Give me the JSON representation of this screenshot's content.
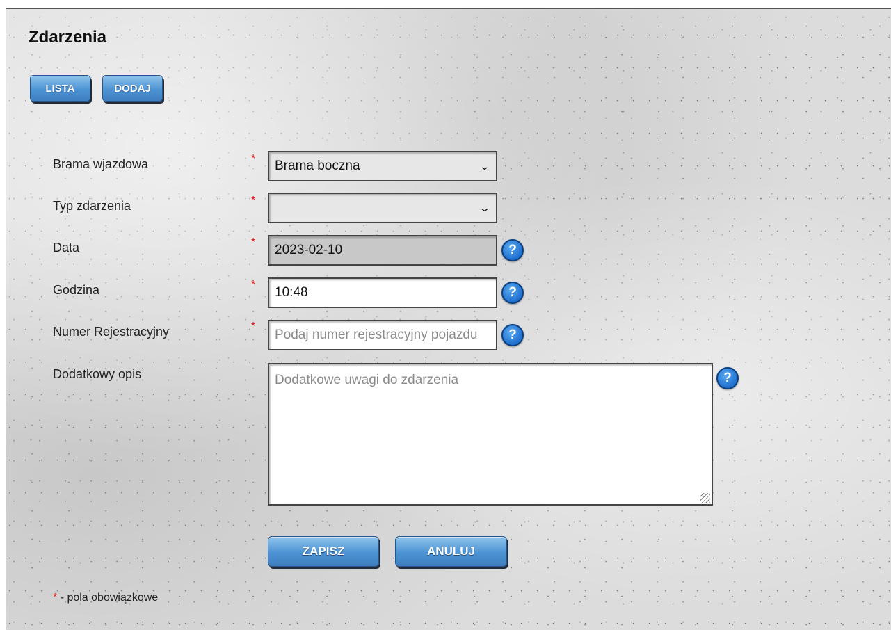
{
  "page": {
    "title": "Zdarzenia"
  },
  "nav": {
    "list_label": "LISTA",
    "add_label": "DODAJ"
  },
  "form": {
    "required_mark": "*",
    "gate": {
      "label": "Brama wjazdowa",
      "value": "Brama boczna"
    },
    "event_type": {
      "label": "Typ zdarzenia",
      "value": ""
    },
    "date": {
      "label": "Data",
      "value": "2023-02-10"
    },
    "time": {
      "label": "Godzina",
      "value": "10:48"
    },
    "plate": {
      "label": "Numer Rejestracyjny",
      "value": "",
      "placeholder": "Podaj numer rejestracyjny pojazdu"
    },
    "description": {
      "label": "Dodatkowy opis",
      "value": "",
      "placeholder": "Dodatkowe uwagi do zdarzenia"
    },
    "help_symbol": "?"
  },
  "actions": {
    "save_label": "ZAPISZ",
    "cancel_label": "ANULUJ"
  },
  "footer": {
    "required_star": "*",
    "required_note": " - pola obowiązkowe"
  },
  "icons": {
    "help": "question-icon",
    "dropdown": "chevron-down-icon",
    "resize": "resize-grip-icon"
  },
  "colors": {
    "button": "#4c93d3",
    "required": "#e31212",
    "help": "#1f6fd0"
  }
}
